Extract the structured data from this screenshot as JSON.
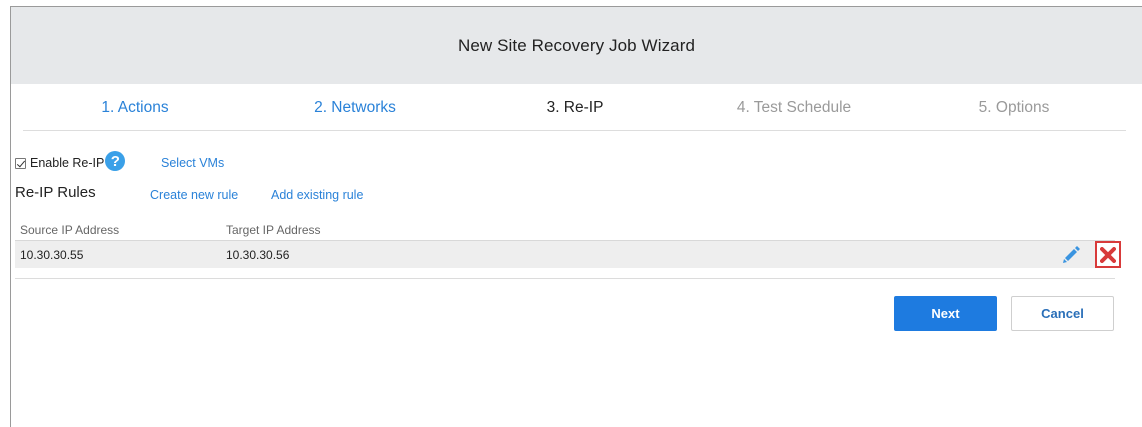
{
  "window": {
    "title": "New Site Recovery Job Wizard"
  },
  "steps": [
    {
      "label": "1. Actions",
      "state": "done"
    },
    {
      "label": "2. Networks",
      "state": "done"
    },
    {
      "label": "3. Re-IP",
      "state": "current"
    },
    {
      "label": "4. Test Schedule",
      "state": "future"
    },
    {
      "label": "5. Options",
      "state": "future"
    }
  ],
  "reip": {
    "enable_label": "Enable Re-IP",
    "enabled": true,
    "help_glyph": "?",
    "select_vms_label": "Select VMs"
  },
  "rules": {
    "title": "Re-IP Rules",
    "create_label": "Create new rule",
    "add_existing_label": "Add existing rule",
    "columns": [
      "Source IP Address",
      "Target IP Address"
    ],
    "rows": [
      {
        "source": "10.30.30.55",
        "target": "10.30.30.56"
      }
    ]
  },
  "buttons": {
    "next": "Next",
    "cancel": "Cancel"
  },
  "icons": {
    "help": "help-icon",
    "edit": "pencil-icon",
    "delete": "close-x-icon"
  },
  "colors": {
    "link": "#2a82d8",
    "primary": "#1e7be0",
    "delete": "#d83a3a",
    "help": "#3aa0e8"
  }
}
